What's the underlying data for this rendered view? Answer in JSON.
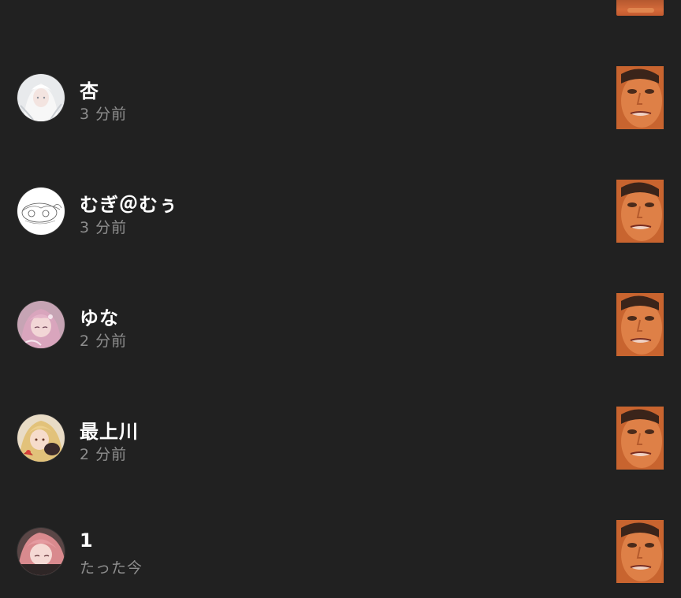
{
  "activity": {
    "items": [
      {
        "name": "杏",
        "time": "3 分前",
        "avatar_icon": "anime-avatar-white-hair",
        "thumb_icon": "post-thumbnail-face"
      },
      {
        "name": "むぎ＠むぅ",
        "time": "3 分前",
        "avatar_icon": "sketch-avatar",
        "thumb_icon": "post-thumbnail-face"
      },
      {
        "name": "ゆな",
        "time": "2 分前",
        "avatar_icon": "anime-avatar-pink-hair",
        "thumb_icon": "post-thumbnail-face"
      },
      {
        "name": "最上川",
        "time": "2 分前",
        "avatar_icon": "anime-avatar-blonde-hair",
        "thumb_icon": "post-thumbnail-face"
      },
      {
        "name": "1",
        "time": "たった今",
        "avatar_icon": "anime-avatar-red-hair",
        "thumb_icon": "post-thumbnail-face"
      }
    ]
  },
  "colors": {
    "background": "#212121",
    "name_text": "#ffffff",
    "time_text": "#8e8e8e",
    "thumb_skin": "#d8773f"
  }
}
